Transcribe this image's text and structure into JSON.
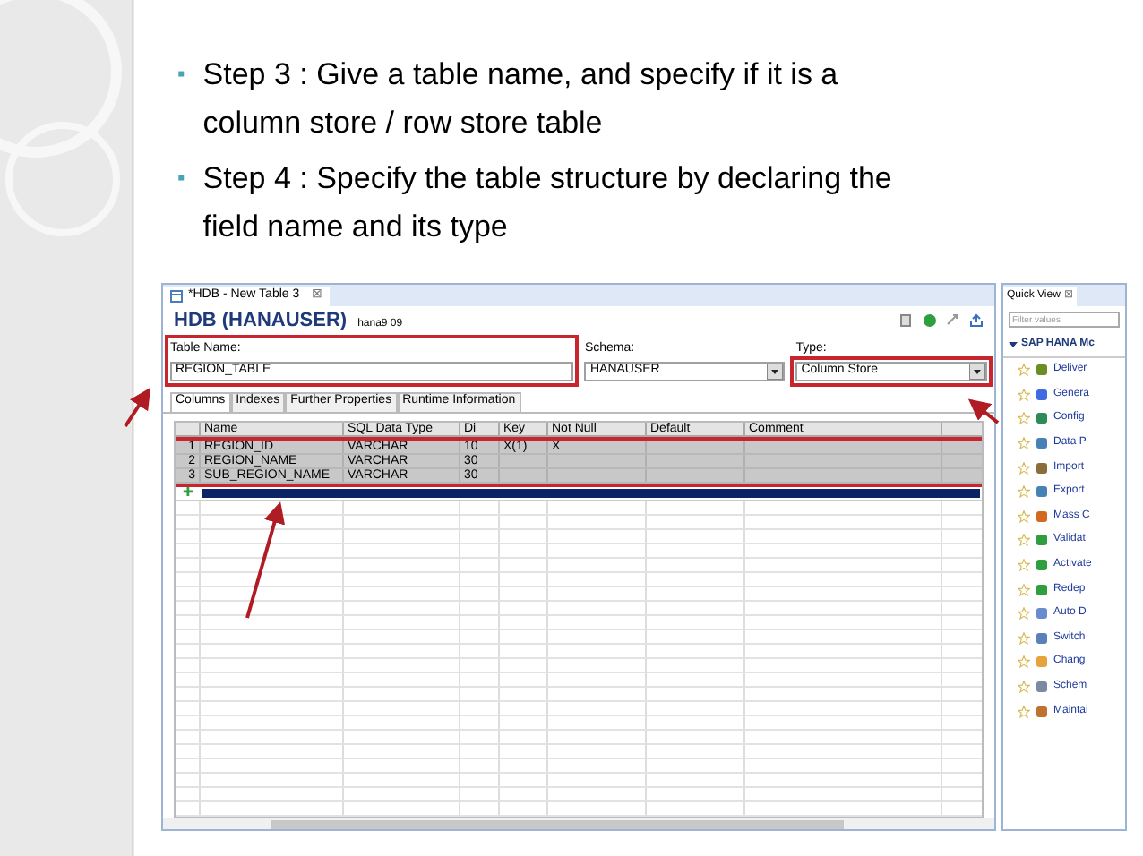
{
  "bullets": [
    {
      "marker": "▪",
      "text": "Step 3 : Give a table name, and specify if it is a column store / row store table"
    },
    {
      "marker": "▪",
      "text": "Step 4 : Specify the table structure by declaring the field name and its type"
    }
  ],
  "editor": {
    "tab": "*HDB - New Table 3",
    "tab_close": "⊠",
    "title": "HDB (HANAUSER)",
    "subtitle": "hana9 09",
    "fields": [
      {
        "label": "Table Name:",
        "value": "REGION_TABLE",
        "kind": "text"
      },
      {
        "label": "Schema:",
        "value": "HANAUSER",
        "kind": "dropdown"
      },
      {
        "label": "Type:",
        "value": "Column Store",
        "kind": "dropdown"
      }
    ],
    "tabs": [
      {
        "label": "Columns",
        "selected": true
      },
      {
        "label": "Indexes",
        "selected": false
      },
      {
        "label": "Further Properties",
        "selected": false
      },
      {
        "label": "Runtime Information",
        "selected": false
      }
    ],
    "table": {
      "columns": [
        "",
        "Name",
        "SQL Data Type",
        "Di",
        "Key",
        "Not Null",
        "Default",
        "Comment"
      ],
      "rows": [
        [
          "1",
          "REGION_ID",
          "VARCHAR",
          "10",
          "X(1)",
          "X",
          "",
          ""
        ],
        [
          "2",
          "REGION_NAME",
          "VARCHAR",
          "30",
          "",
          "",
          "",
          ""
        ],
        [
          "3",
          "SUB_REGION_NAME",
          "VARCHAR",
          "30",
          "",
          "",
          "",
          ""
        ]
      ],
      "new_row_marker": "✚"
    }
  },
  "quick_view": {
    "tab": "Quick View",
    "tab_close": "⊠",
    "filter": {
      "placeholder": "Filter values"
    },
    "group": "SAP HANA Mc",
    "items": [
      "Deliver",
      "Genera",
      "Config",
      "Data P",
      "Import",
      "Export",
      "Mass C",
      "Validat",
      "Activate",
      "Redep",
      "Auto D",
      "Switch",
      "Chang",
      "Schem",
      "Maintai"
    ]
  }
}
